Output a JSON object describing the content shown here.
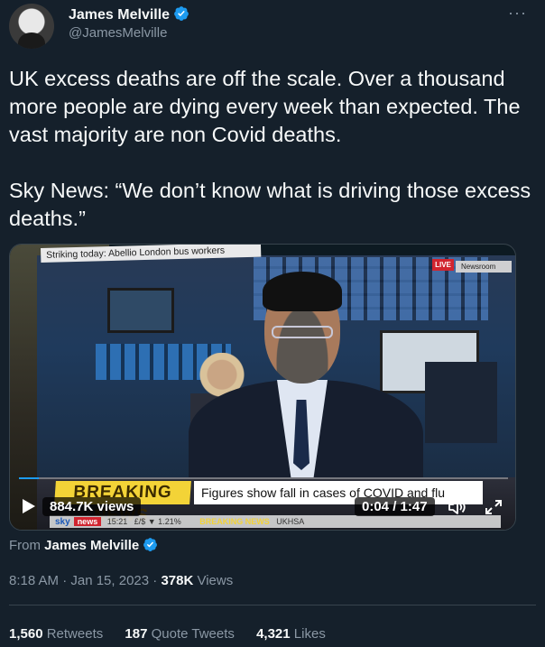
{
  "author": {
    "name": "James Melville",
    "handle": "@JamesMelville"
  },
  "menu": {
    "more_label": "···"
  },
  "tweet": {
    "text": "UK excess deaths are off the scale. Over a thousand more people are dying every week than expected. The vast majority are non Covid deaths.\n\nSky News: “We don’t know what is driving those excess deaths.”"
  },
  "video": {
    "strap_top": "Striking today: Abellio London bus workers",
    "live_label": "LIVE",
    "newsroom_label": "Newsroom",
    "breaking_label": "BREAKING NEWS",
    "headline": "Figures show fall in cases of COVID and flu",
    "ticker": {
      "logo": "sky",
      "news_tag": "news",
      "clock": "15:21",
      "fx": "£/$ ▼ 1.21%",
      "breaking_mini": "BREAKING NEWS",
      "source": "UKHSA"
    },
    "views": "884.7K views",
    "time": "0:04 / 1:47",
    "progress": 0.04,
    "accent": "#1d9bf0"
  },
  "from": {
    "prefix": "From",
    "name": "James Melville"
  },
  "meta": {
    "timestamp": "8:18 AM · Jan 15, 2023 · ",
    "views_count": "378K",
    "views_suffix": " Views"
  },
  "stats": {
    "retweets_count": "1,560",
    "retweets_label": "Retweets",
    "quotes_count": "187",
    "quotes_label": "Quote Tweets",
    "likes_count": "4,321",
    "likes_label": "Likes"
  }
}
